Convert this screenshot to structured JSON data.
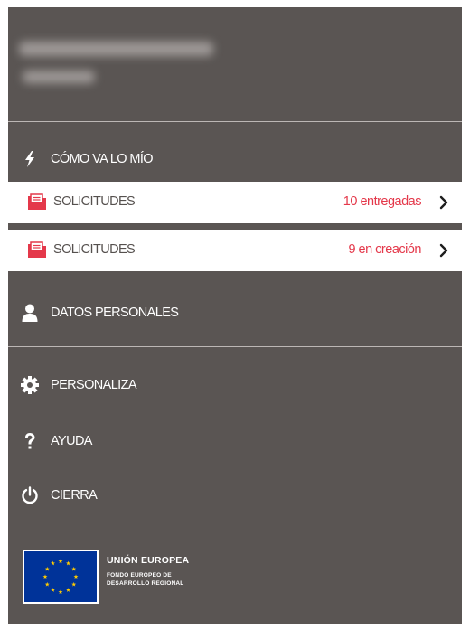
{
  "profile": {
    "name_blurred": "",
    "subtitle_blurred": ""
  },
  "status_section": {
    "label": "CÓMO VA LO MÍO",
    "icon": "lightning-bolt-icon"
  },
  "cards": [
    {
      "label": "SOLICITUDES",
      "status": "10 entregadas",
      "icon": "document-folder-icon"
    },
    {
      "label": "SOLICITUDES",
      "status": "9 en creación",
      "icon": "document-folder-icon"
    }
  ],
  "menu": {
    "personal_data": {
      "label": "DATOS PERSONALES",
      "icon": "user-icon"
    },
    "customize": {
      "label": "PERSONALIZA",
      "icon": "gear-icon"
    },
    "help": {
      "label": "AYUDA",
      "icon": "question-mark-icon"
    },
    "close": {
      "label": "CIERRA",
      "icon": "power-icon"
    }
  },
  "eu": {
    "title": "UNIÓN EUROPEA",
    "line1": "FONDO EUROPEO DE",
    "line2": "DESARROLLO REGIONAL",
    "icon": "eu-flag-icon"
  },
  "colors": {
    "panel_background": "#5a5553",
    "card_background": "#ffffff",
    "accent_red": "#e4384a",
    "divider": "#bcb7b5",
    "eu_blue": "#003399",
    "eu_star": "#ffcc00"
  }
}
